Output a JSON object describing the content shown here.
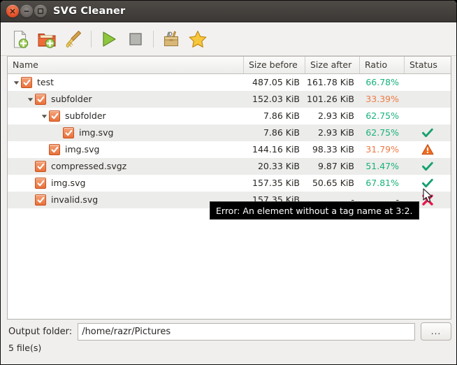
{
  "window": {
    "title": "SVG Cleaner",
    "buttons": [
      {
        "name": "close",
        "icon": "close-icon"
      },
      {
        "name": "minimize",
        "icon": "minimize-icon"
      },
      {
        "name": "maximize",
        "icon": "maximize-icon"
      }
    ]
  },
  "toolbar": {
    "items": [
      {
        "name": "add-files-button",
        "icon": "document-add-icon",
        "tooltip": "Add files"
      },
      {
        "name": "add-folder-button",
        "icon": "folder-add-icon",
        "tooltip": "Add folder"
      },
      {
        "name": "clear-list-button",
        "icon": "broom-icon",
        "tooltip": "Clear list"
      },
      {
        "name": "start-button",
        "icon": "play-icon",
        "tooltip": "Start"
      },
      {
        "name": "stop-button",
        "icon": "stop-icon",
        "tooltip": "Stop"
      },
      {
        "name": "preferences-button",
        "icon": "toolbox-icon",
        "tooltip": "Preferences"
      },
      {
        "name": "presets-button",
        "icon": "star-icon",
        "tooltip": "Presets"
      }
    ]
  },
  "tree": {
    "columns": [
      {
        "key": "name",
        "label": "Name"
      },
      {
        "key": "size_before",
        "label": "Size before"
      },
      {
        "key": "size_after",
        "label": "Size after"
      },
      {
        "key": "ratio",
        "label": "Ratio"
      },
      {
        "key": "status",
        "label": "Status"
      }
    ],
    "rows": [
      {
        "name": "test",
        "depth": 0,
        "expander": "expanded",
        "checked": true,
        "size_before": "487.05 KiB",
        "size_after": "161.78 KiB",
        "ratio": "66.78%",
        "ratio_state": "good",
        "status": "none"
      },
      {
        "name": "subfolder",
        "depth": 1,
        "expander": "expanded",
        "checked": true,
        "size_before": "152.03 KiB",
        "size_after": "101.26 KiB",
        "ratio": "33.39%",
        "ratio_state": "warn",
        "status": "none"
      },
      {
        "name": "subfolder",
        "depth": 2,
        "expander": "expanded",
        "checked": true,
        "size_before": "7.86 KiB",
        "size_after": "2.93 KiB",
        "ratio": "62.75%",
        "ratio_state": "good",
        "status": "none"
      },
      {
        "name": "img.svg",
        "depth": 3,
        "expander": "none",
        "checked": true,
        "size_before": "7.86 KiB",
        "size_after": "2.93 KiB",
        "ratio": "62.75%",
        "ratio_state": "good",
        "status": "ok"
      },
      {
        "name": "img.svg",
        "depth": 2,
        "expander": "none",
        "checked": true,
        "size_before": "144.16 KiB",
        "size_after": "98.33 KiB",
        "ratio": "31.79%",
        "ratio_state": "warn",
        "status": "warning"
      },
      {
        "name": "compressed.svgz",
        "depth": 1,
        "expander": "none",
        "checked": true,
        "size_before": "20.33 KiB",
        "size_after": "9.87 KiB",
        "ratio": "51.47%",
        "ratio_state": "good",
        "status": "ok"
      },
      {
        "name": "img.svg",
        "depth": 1,
        "expander": "none",
        "checked": true,
        "size_before": "157.35 KiB",
        "size_after": "50.65 KiB",
        "ratio": "67.81%",
        "ratio_state": "good",
        "status": "ok"
      },
      {
        "name": "invalid.svg",
        "depth": 1,
        "expander": "none",
        "checked": true,
        "size_before": "157.35 KiB",
        "size_after": "-",
        "ratio": "-",
        "ratio_state": "dash",
        "status": "error"
      }
    ]
  },
  "tooltip": {
    "text": "Error: An element without a tag name at 3:2."
  },
  "bottom": {
    "output_label": "Output folder:",
    "output_value": "/home/razr/Pictures",
    "output_placeholder": "",
    "browse_label": "...",
    "status_text": "5 file(s)"
  },
  "colors": {
    "accent_orange": "#e8703a",
    "ratio_good": "#18b27a",
    "ratio_warn": "#ef7a45",
    "status_ok": "#16a070",
    "status_warning": "#ef6c22",
    "status_error": "#e8174b",
    "titlebar": "#3c3835",
    "window_bg": "#f0efee"
  }
}
